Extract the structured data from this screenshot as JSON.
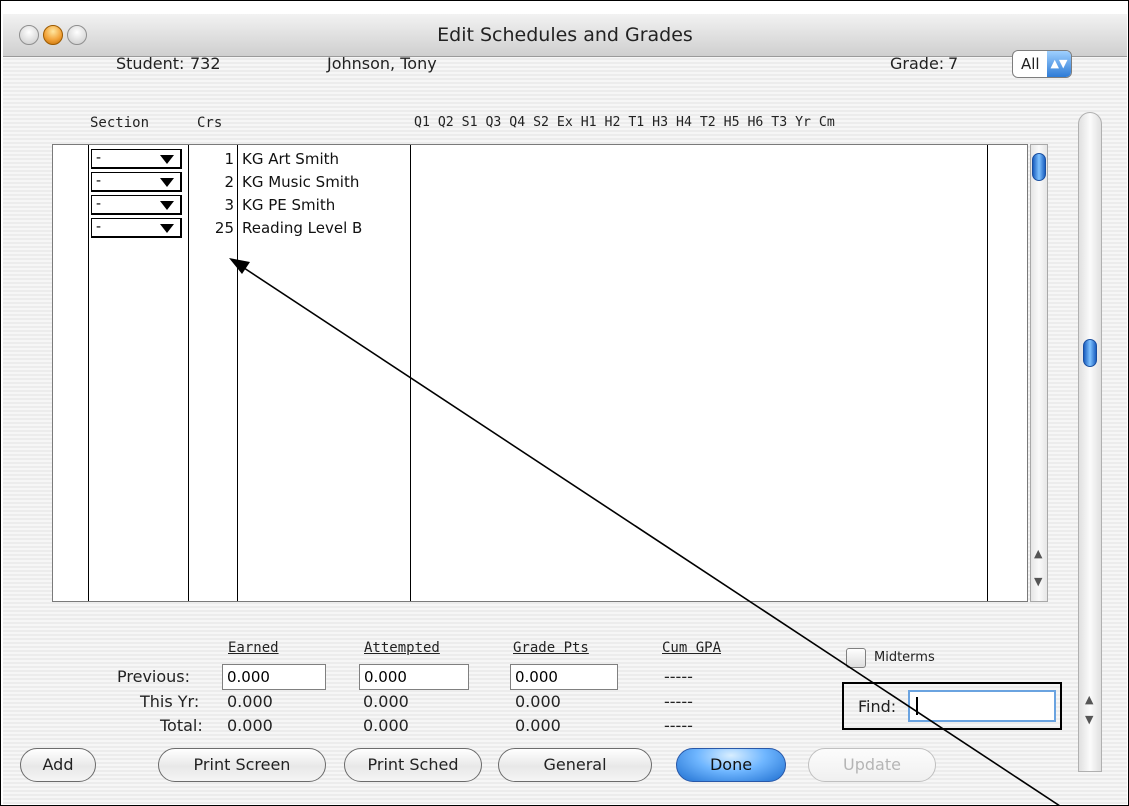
{
  "window": {
    "title": "Edit Schedules and Grades"
  },
  "header": {
    "student_label": "Student:",
    "student_id": "732",
    "student_name": "Johnson, Tony",
    "grade_label": "Grade:",
    "grade_value": "7",
    "filter_value": "All"
  },
  "columns": {
    "section": "Section",
    "crs": "Crs",
    "periods": "Q1 Q2 S1 Q3 Q4 S2 Ex H1 H2 T1 H3 H4 T2 H5 H6 T3 Yr Cm"
  },
  "rows": [
    {
      "section": "-",
      "num": "1",
      "course": "KG Art Smith"
    },
    {
      "section": "-",
      "num": "2",
      "course": "KG Music Smith"
    },
    {
      "section": "-",
      "num": "3",
      "course": "KG PE Smith"
    },
    {
      "section": "-",
      "num": "25",
      "course": "Reading Level B"
    }
  ],
  "totals": {
    "headers": {
      "earned": "Earned",
      "attempted": "Attempted",
      "grade_pts": "Grade Pts",
      "cum_gpa": "Cum GPA"
    },
    "previous": {
      "label": "Previous:",
      "earned": "0.000",
      "attempted": "0.000",
      "grade_pts": "0.000",
      "cum_gpa": "-----"
    },
    "this_yr": {
      "label": "This Yr:",
      "earned": "0.000",
      "attempted": "0.000",
      "grade_pts": "0.000",
      "cum_gpa": "-----"
    },
    "total": {
      "label": "Total:",
      "earned": "0.000",
      "attempted": "0.000",
      "grade_pts": "0.000",
      "cum_gpa": "-----"
    }
  },
  "midterms_label": "Midterms",
  "find": {
    "label": "Find:",
    "value": ""
  },
  "buttons": {
    "add": "Add",
    "print_screen": "Print Screen",
    "print_sched": "Print Sched",
    "general": "General",
    "done": "Done",
    "update": "Update"
  },
  "icons": {
    "close": "close-light-icon",
    "minimize": "minimize-light-icon",
    "zoom": "zoom-light-icon",
    "arrow": "annotation-arrow"
  },
  "colors": {
    "accent": "#2e7bd6",
    "minimize": "#f2a33a"
  }
}
